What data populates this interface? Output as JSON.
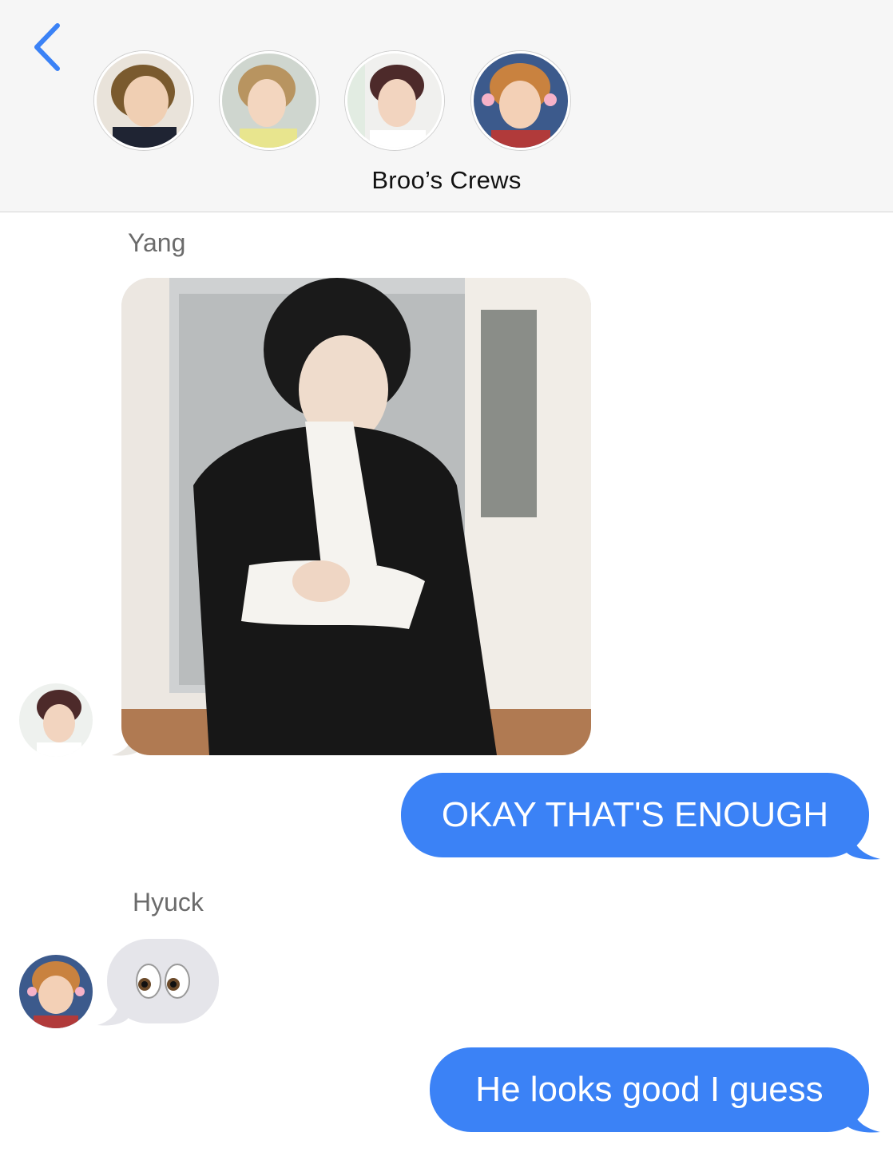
{
  "header": {
    "back_icon": "chevron-left-icon",
    "title": "Broo’s Crews",
    "accent_color": "#3b82f6",
    "participants": [
      "participant-1",
      "participant-2",
      "participant-3",
      "participant-4"
    ]
  },
  "messages": [
    {
      "sender": "Yang",
      "type": "image",
      "direction": "incoming"
    },
    {
      "type": "text",
      "direction": "outgoing",
      "text": "OKAY THAT'S ENOUGH"
    },
    {
      "sender": "Hyuck",
      "type": "emoji",
      "direction": "incoming",
      "text": "👀",
      "icon": "eyes-emoji-icon"
    },
    {
      "type": "text",
      "direction": "outgoing",
      "text": "He looks good I guess"
    }
  ],
  "colors": {
    "outgoing_bubble": "#3b82f6",
    "incoming_bubble": "#e5e5ea"
  }
}
